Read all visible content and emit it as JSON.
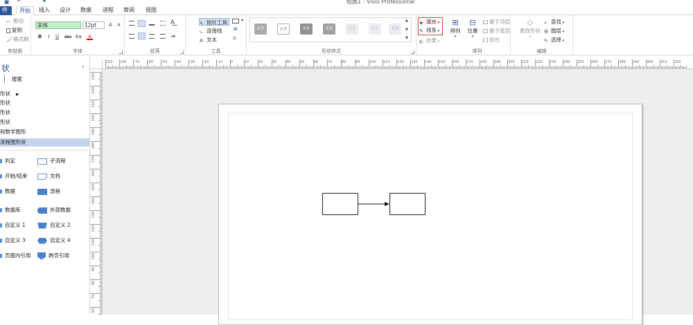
{
  "window": {
    "title": "绘图1 - Visio Professional"
  },
  "tabs": [
    {
      "label": "件",
      "type": "file"
    },
    {
      "label": "开始",
      "type": "active"
    },
    {
      "label": "插入"
    },
    {
      "label": "设计"
    },
    {
      "label": "数据"
    },
    {
      "label": "进程"
    },
    {
      "label": "审阅"
    },
    {
      "label": "视图"
    }
  ],
  "ribbon": {
    "clipboard": {
      "cut": "剪切",
      "copy": "复制",
      "format_painter": "格式刷",
      "label": "剪贴板"
    },
    "font": {
      "family": "宋体",
      "size": "12pt",
      "label": "字体",
      "bold": "B",
      "italic": "I",
      "underline": "U",
      "strike": "abc",
      "case": "Aa",
      "color": "A"
    },
    "paragraph": {
      "label": "段落"
    },
    "tools": {
      "pointer": "指针工具",
      "connector": "连接线",
      "text": "文本",
      "label": "工具"
    },
    "shape_styles": {
      "sample": "文字",
      "label": "形状样式"
    },
    "fill": {
      "fill": "填充",
      "line": "线条",
      "effect": "效果"
    },
    "arrange": {
      "arrange": "排列",
      "position": "位置",
      "bring_front": "置于顶层",
      "send_back": "置于底层",
      "group": "组合",
      "label": "排列"
    },
    "editing": {
      "change_shape": "更改形状",
      "find": "查找",
      "layers": "图层",
      "select": "选择",
      "label": "编辑"
    },
    "colors": {
      "accent": "#2b579a",
      "grey": "#a9a9a9",
      "light": "#e8e8f3"
    }
  },
  "sidebar": {
    "title": "状",
    "search": "搜索",
    "categories": [
      "形状",
      "形状",
      "形状",
      "形状",
      "和数学图形",
      "流程图形状"
    ],
    "stencils": [
      {
        "left": "判定",
        "right": "子流程"
      },
      {
        "left": "开始/结束",
        "right": "文档"
      },
      {
        "left": "数据",
        "right": "流程"
      },
      {
        "left": "数据库",
        "right": "外部数据"
      },
      {
        "left": "自定义 1",
        "right": "自定义 2"
      },
      {
        "left": "自定义 3",
        "right": "自定义 4"
      },
      {
        "left": "页面内引用",
        "right": "跨页引用"
      }
    ]
  },
  "ruler": {
    "h_labels": [
      "150",
      "140",
      "-70",
      "-60",
      "-50",
      "-40",
      "-30",
      "-20",
      "-10",
      "0",
      "10",
      "20",
      "30",
      "40",
      "50",
      "60",
      "70",
      "80",
      "90",
      "100",
      "110",
      "120",
      "130",
      "140",
      "150",
      "160",
      "170",
      "180",
      "190",
      "200",
      "210",
      "220",
      "230",
      "240",
      "250",
      "260",
      "270",
      "280",
      "290",
      "300",
      "310",
      "320"
    ],
    "v_labels": [
      "230",
      "220",
      "210",
      "200",
      "190",
      "180",
      "170",
      "160",
      "150",
      "140",
      "130",
      "120",
      "110",
      "100",
      "90",
      "80",
      "70",
      "60"
    ]
  }
}
